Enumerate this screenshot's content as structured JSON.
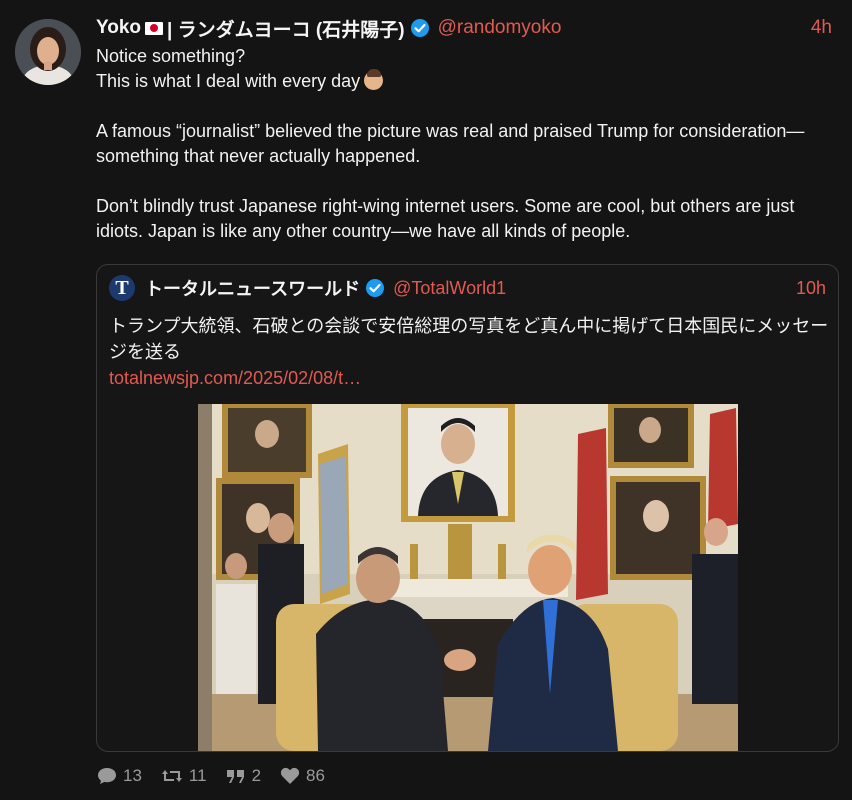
{
  "tweet": {
    "author_name": "Yoko",
    "author_name_suffix": "| ランダムヨーコ (石井陽子)",
    "handle": "@randomyoko",
    "time": "4h",
    "lines": [
      "Notice something?",
      "This is what I deal with every day",
      "A famous “journalist” believed the picture was real and praised Trump for consideration—something that never actually happened.",
      "Don’t blindly trust Japanese right-wing internet users. Some are cool, but others are just idiots. Japan is like any other country—we have all kinds of people."
    ]
  },
  "quote": {
    "avatar_letter": "T",
    "author_name": "トータルニュースワールド",
    "handle": "@TotalWorld1",
    "time": "10h",
    "text": "トランプ大統領、石破との会談で安倍総理の写真をど真ん中に掲げて日本国民にメッセージを送る",
    "link": "totalnewsjp.com/2025/02/08/t…"
  },
  "actions": {
    "replies": "13",
    "retweets": "11",
    "quotes": "2",
    "likes": "86"
  },
  "colors": {
    "background": "#141414",
    "accent": "#e15a52",
    "verified": "#1d9bf0",
    "muted": "#9a9a9a"
  },
  "icons": {
    "verified": "verified-badge-icon",
    "reply": "reply-icon",
    "retweet": "retweet-icon",
    "quote": "quote-icon",
    "like": "heart-icon"
  }
}
